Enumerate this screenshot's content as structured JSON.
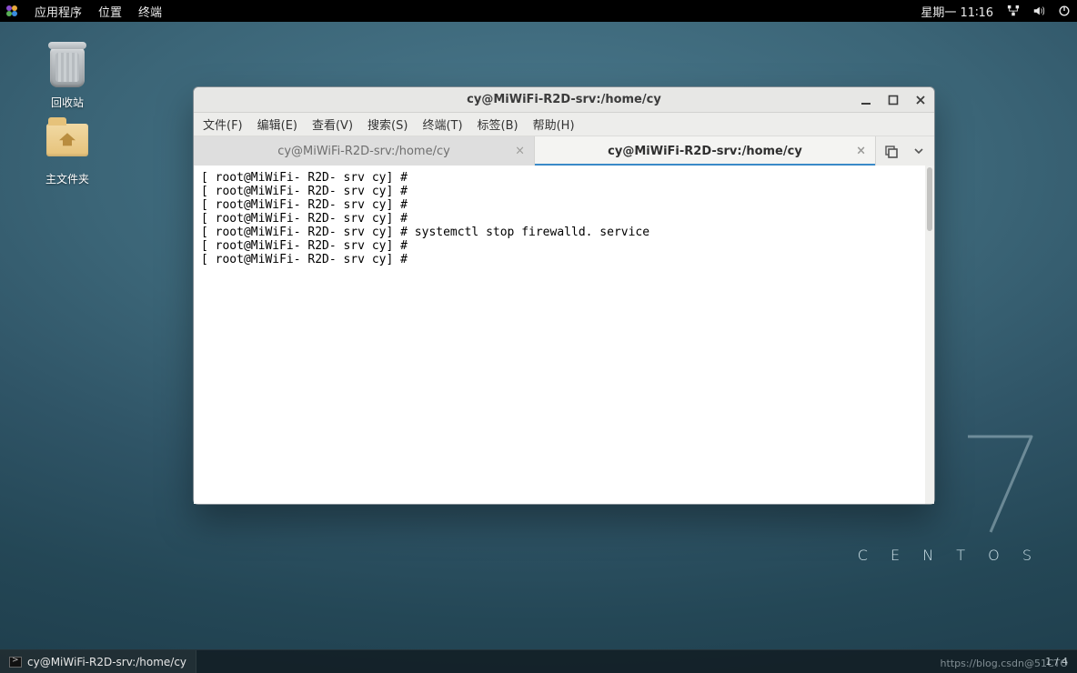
{
  "panel": {
    "apps": "应用程序",
    "places": "位置",
    "terminal": "终端",
    "clock": "星期一 11∶16"
  },
  "desktop": {
    "trash_label": "回收站",
    "home_label": "主文件夹"
  },
  "wallpaper": {
    "brand": "C E N T O S"
  },
  "window": {
    "title": "cy@MiWiFi-R2D-srv:/home/cy",
    "menus": {
      "file": "文件(F)",
      "edit": "编辑(E)",
      "view": "查看(V)",
      "search": "搜索(S)",
      "terminal": "终端(T)",
      "tabs": "标签(B)",
      "help": "帮助(H)"
    },
    "tabs": {
      "tab1_label": "cy@MiWiFi-R2D-srv:/home/cy",
      "tab2_label": "cy@MiWiFi-R2D-srv:/home/cy"
    },
    "terminal_lines": [
      "[ root@MiWiFi- R2D- srv cy] #",
      "[ root@MiWiFi- R2D- srv cy] #",
      "[ root@MiWiFi- R2D- srv cy] #",
      "[ root@MiWiFi- R2D- srv cy] #",
      "[ root@MiWiFi- R2D- srv cy] # systemctl stop firewalld. service",
      "[ root@MiWiFi- R2D- srv cy] #",
      "[ root@MiWiFi- R2D- srv cy] #"
    ]
  },
  "taskbar": {
    "task1_label": "cy@MiWiFi-R2D-srv:/home/cy",
    "corner_text": "1 / 4"
  },
  "watermark_text": "https://blog.csdn@51CTO"
}
